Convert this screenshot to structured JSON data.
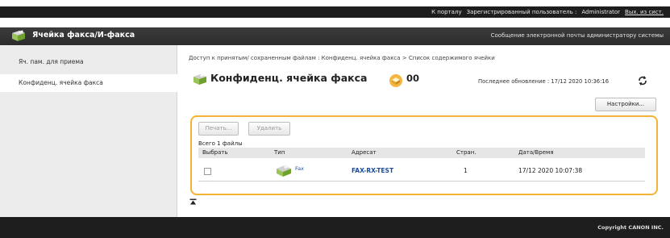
{
  "topbar": {
    "portal_link": "К порталу",
    "registered_user_label": "Зарегистрированный пользователь :",
    "username": "Administrator",
    "logout_link": "Вых. из сист."
  },
  "header": {
    "title": "Ячейка факса/И-факса",
    "email_admin_link": "Сообщение электронной почты администратору системы"
  },
  "sidebar": {
    "items": [
      {
        "label": "Яч. пам. для приема",
        "active": false
      },
      {
        "label": "Конфиденц. ячейка факса",
        "active": true
      }
    ]
  },
  "main": {
    "breadcrumb": {
      "part1": "Доступ к принятым/ сохраненным файлам",
      "sep1": " : ",
      "part2": "Конфиденц. ячейка факса",
      "sep2": " > ",
      "part3": "Список содержимого ячейки"
    },
    "title": "Конфиденц. ячейка факса",
    "box_number": "00",
    "last_update": "Последнее обновление : 17/12 2020 10:36:16",
    "settings_button": "Настройки...",
    "print_button": "Печать...",
    "delete_button": "Удалить",
    "total_files": "Всего 1 файлы",
    "table": {
      "headers": [
        "Выбрать",
        "Тип",
        "Адресат",
        "Стран.",
        "Дата/Время"
      ],
      "rows": [
        {
          "type": "Fax",
          "recipient": "FAX-RX-TEST",
          "pages": "1",
          "datetime": "17/12 2020 10:07:38"
        }
      ]
    }
  },
  "footer": {
    "copyright": "Copyright CANON INC."
  },
  "colors": {
    "accent_panel_border": "#f5b335",
    "link_blue": "#1b4f9c",
    "dark_bar": "#1e1e1e"
  },
  "icons": {
    "header": "fax-machine-icon",
    "page": "fax-machine-icon",
    "badge": "box-badge-icon",
    "refresh": "refresh-icon",
    "row_type": "fax-machine-icon",
    "scroll": "scroll-to-top-icon"
  }
}
